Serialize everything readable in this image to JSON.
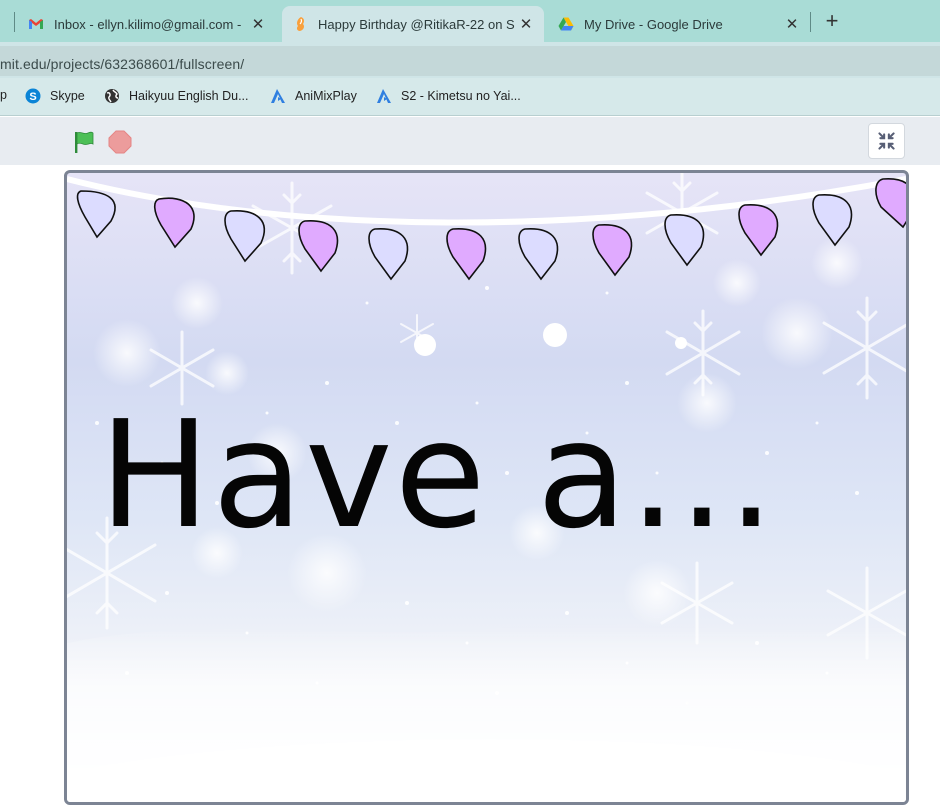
{
  "browser": {
    "tabs": [
      {
        "title": "Inbox - ellyn.kilimo@gmail.com -",
        "icon": "gmail-icon",
        "active": false
      },
      {
        "title": "Happy Birthday @RitikaR-22 on S",
        "icon": "scratch-icon",
        "active": true
      },
      {
        "title": "My Drive - Google Drive",
        "icon": "google-drive-icon",
        "active": false
      }
    ],
    "new_tab_label": "+",
    "url": "mit.edu/projects/632368601/fullscreen/",
    "bookmarks": [
      {
        "label": "p",
        "icon": "apps-icon"
      },
      {
        "label": "Skype",
        "icon": "skype-icon"
      },
      {
        "label": "Haikyuu English Du...",
        "icon": "globe-icon"
      },
      {
        "label": "AniMixPlay",
        "icon": "animixplay-icon"
      },
      {
        "label": "S2 - Kimetsu no Yai...",
        "icon": "animixplay-icon"
      }
    ]
  },
  "player": {
    "green_flag_icon": "green-flag-icon",
    "stop_icon": "stop-sign-icon",
    "exit_fullscreen_icon": "exit-fullscreen-icon"
  },
  "stage": {
    "headline": "Have a...",
    "colors": {
      "bulb_purple": "#e0aaff",
      "bulb_lavender": "#dcdcff",
      "text": "#050505"
    }
  }
}
